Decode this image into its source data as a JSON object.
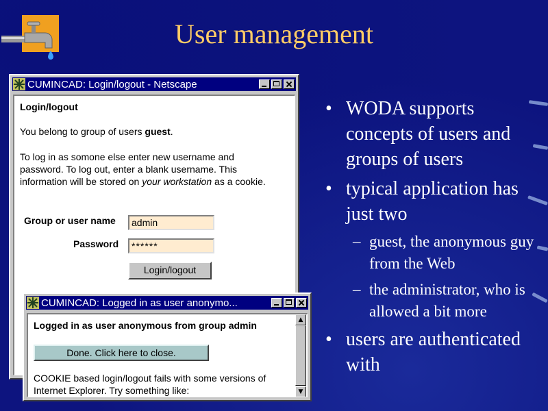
{
  "slide": {
    "title": "User management",
    "bullets": [
      {
        "level": 1,
        "text": "WODA supports concepts of users and groups of users"
      },
      {
        "level": 1,
        "text": "typical application has just two"
      },
      {
        "level": 2,
        "text": "guest, the anonymous guy from the Web"
      },
      {
        "level": 2,
        "text": "the administrator, who is allowed a bit more"
      },
      {
        "level": 1,
        "text": "users are authenticated with"
      }
    ],
    "bullet_marker": "•",
    "sub_marker": "–",
    "colors": {
      "background": "#0d147f",
      "title": "#ffcc66",
      "text": "#ffffff"
    }
  },
  "login_window": {
    "title": "CUMINCAD: Login/logout - Netscape",
    "heading": "Login/logout",
    "group_text_prefix": "You belong to group of users ",
    "group_name": "guest",
    "group_text_suffix": ".",
    "instructions_1": "To log in as somone else enter new username and password. To log out, enter a blank username. This information will be stored on ",
    "instructions_em": "your workstation",
    "instructions_2": " as a cookie.",
    "username_label": "Group or user name",
    "username_value": "admin",
    "password_label": "Password",
    "password_value": "******",
    "submit_label": "Login/logout"
  },
  "confirm_window": {
    "title": "CUMINCAD: Logged in as user anonymo...",
    "message": "Logged in as user anonymous from group admin",
    "done_label": "Done. Click here to close.",
    "cookie_note": "COOKIE based login/logout fails with some versions of Internet Explorer. Try something like:"
  },
  "icons": {
    "window_icon": "netscape-icon",
    "logo": "faucet-icon",
    "minimize": "minimize-icon",
    "maximize": "maximize-icon",
    "close": "close-icon",
    "scroll_up": "arrow-up-icon",
    "scroll_down": "arrow-down-icon"
  }
}
